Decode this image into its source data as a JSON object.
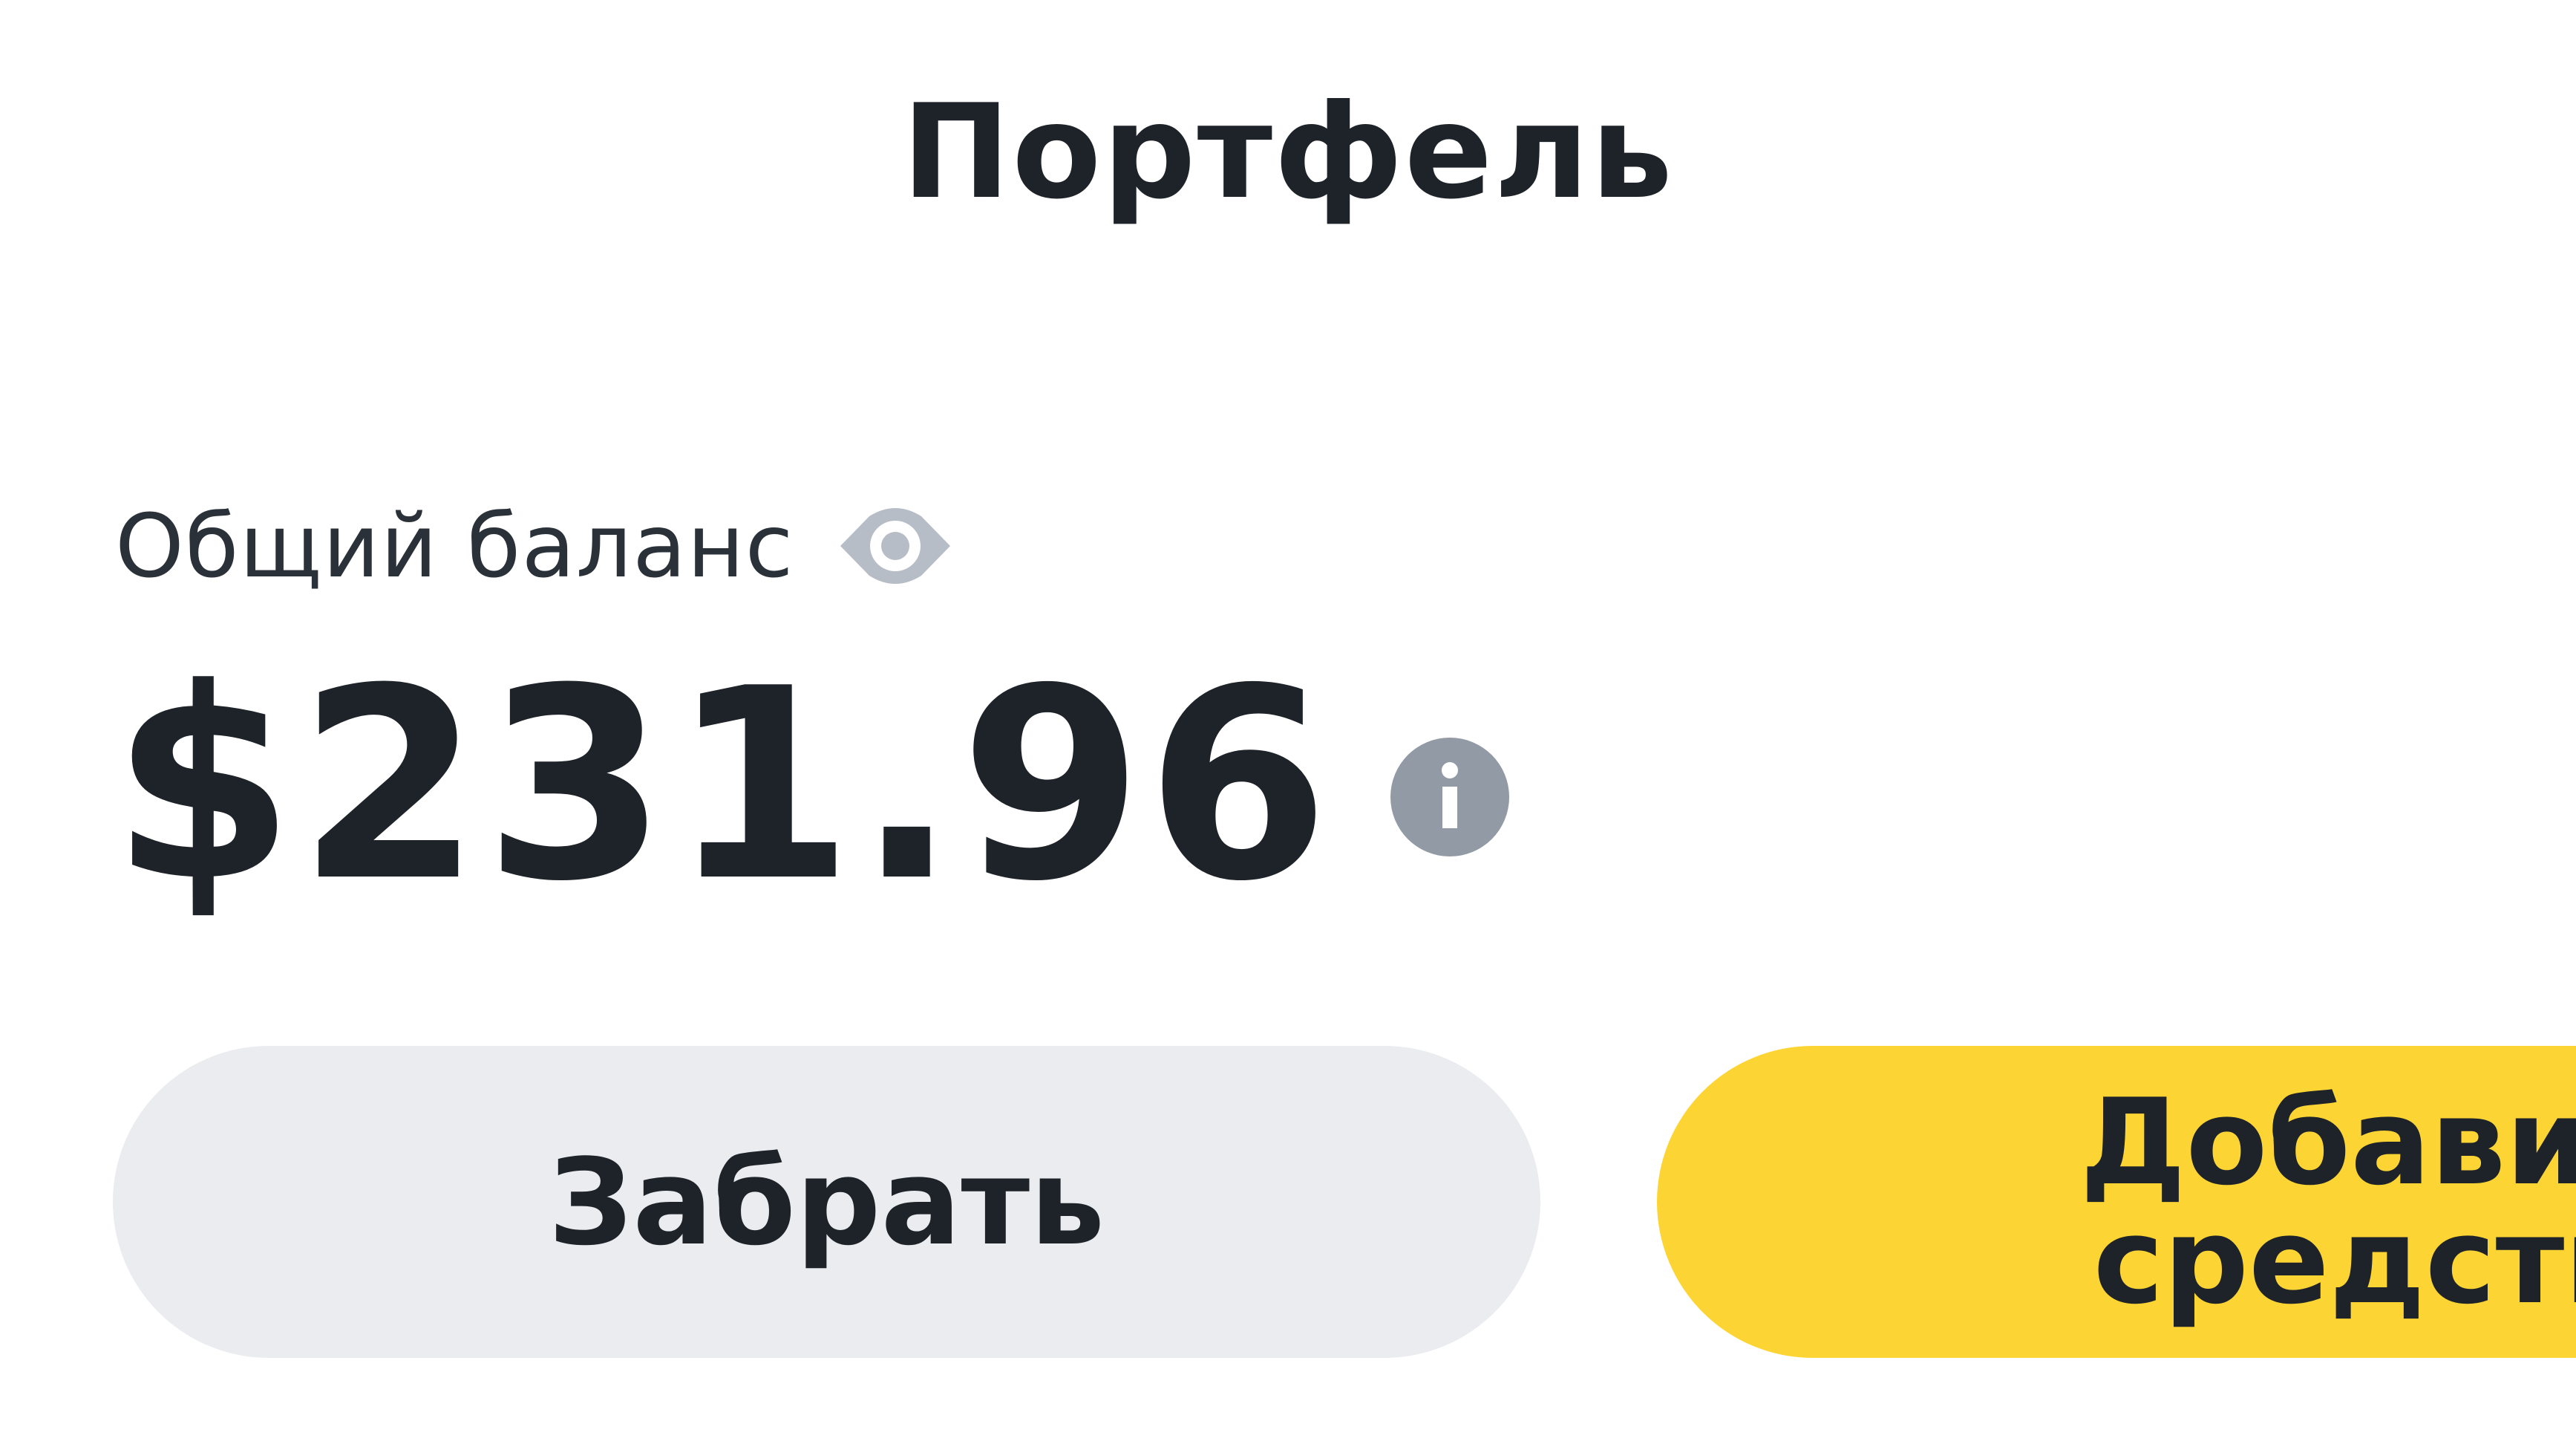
{
  "header": {
    "title": "Портфель"
  },
  "balance": {
    "label": "Общий баланс",
    "amount": "$231.96",
    "visibility_icon": "eye-icon",
    "info_icon": "info-icon"
  },
  "actions": {
    "withdraw_label": "Забрать",
    "deposit_label": "Добавить\nсредства"
  },
  "colors": {
    "text_primary": "#1e2329",
    "icon_gray": "#929aa5",
    "eye_gray": "#b7bdc6",
    "secondary_button": "#eaecef",
    "primary_button": "#fcd535"
  }
}
